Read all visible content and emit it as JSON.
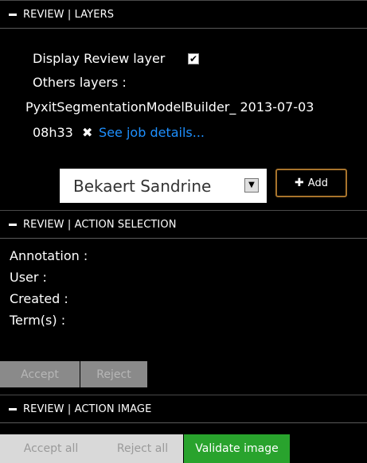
{
  "layers_panel": {
    "title": "REVIEW | LAYERS",
    "display_review_label": "Display Review layer",
    "display_review_checked": true,
    "others_label": "Others layers   :",
    "layer_name_line1": "PyxitSegmentationModelBuilder_ 2013-07-03",
    "layer_name_line2": "08h33",
    "see_job_link": "See job details...",
    "user_select_value": "Bekaert Sandrine",
    "add_button_label": "Add"
  },
  "selection_panel": {
    "title": "REVIEW | ACTION SELECTION",
    "annotation_label": "Annotation :",
    "user_label": "User :",
    "created_label": "Created :",
    "terms_label": "Term(s) :",
    "accept_label": "Accept",
    "reject_label": "Reject"
  },
  "image_panel": {
    "title": "REVIEW | ACTION IMAGE",
    "accept_all_label": "Accept all",
    "reject_all_label": "Reject all",
    "validate_label": "Validate image"
  },
  "colors": {
    "background": "#000000",
    "link": "#1e90ff",
    "add_border": "#a8742c",
    "validate_green": "#29a32d",
    "disabled_gray": "#8a8a8a"
  },
  "icons": [
    "minus-icon",
    "check-icon",
    "close-icon",
    "chevron-down-icon",
    "plus-icon"
  ]
}
